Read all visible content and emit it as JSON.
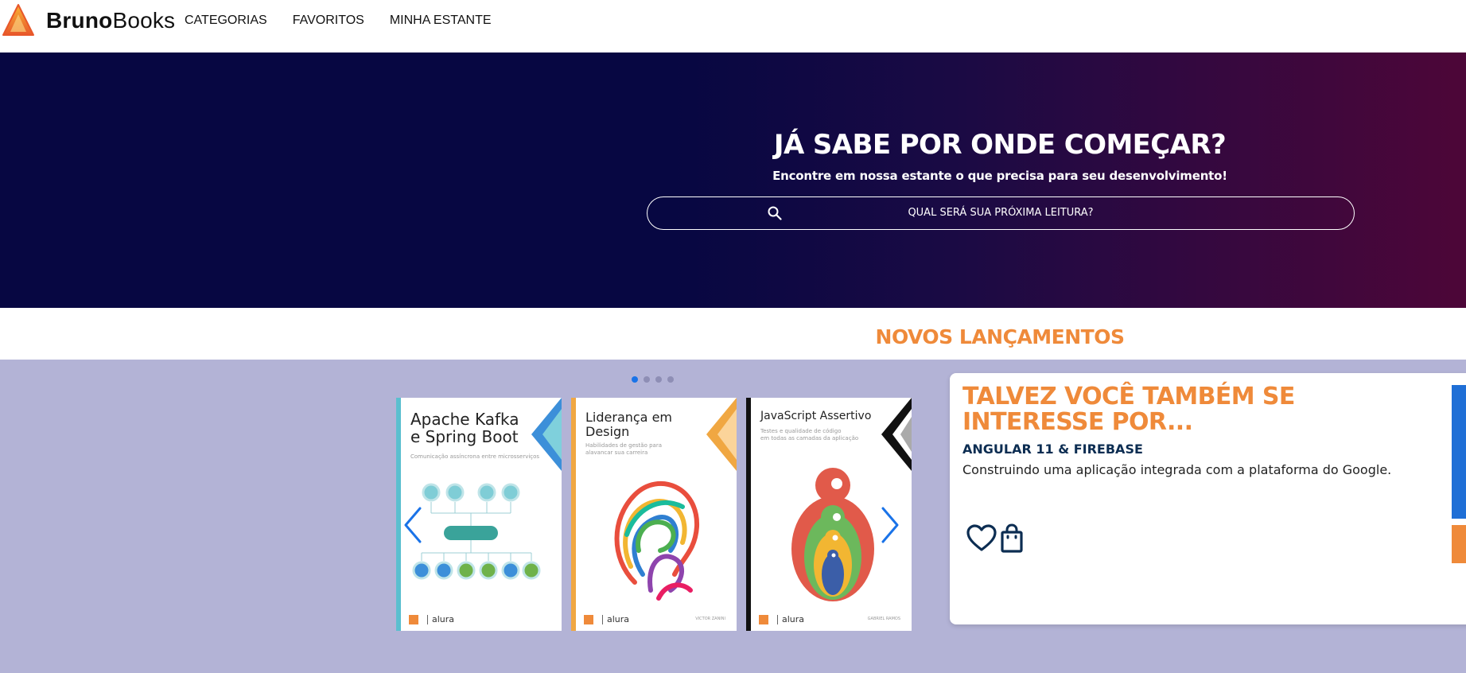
{
  "header": {
    "brand_bold": "Bruno",
    "brand_light": "Books",
    "nav": [
      {
        "label": "CATEGORIAS"
      },
      {
        "label": "FAVORITOS"
      },
      {
        "label": "MINHA ESTANTE"
      }
    ]
  },
  "hero": {
    "title": "JÁ SABE POR ONDE COMEÇAR?",
    "subtitle": "Encontre em nossa estante o que precisa para seu desenvolvimento!",
    "search_placeholder": "QUAL SERÁ SUA PRÓXIMA LEITURA?",
    "search_icon": "search-icon"
  },
  "releases": {
    "title": "NOVOS LANÇAMENTOS",
    "active_page": 1,
    "books": [
      {
        "title_line1": "Apache Kafka",
        "title_line2": "e Spring Boot",
        "subtitle": "Comunicação assíncrona entre microsserviços",
        "accent": "#5bbfcf",
        "publisher": "alura"
      },
      {
        "title_line1": "Liderança em",
        "title_line2": "Design",
        "subtitle": "Habilidades de gestão para\nalavancar sua carreira",
        "accent": "#f0a742",
        "publisher": "alura",
        "author": "VICTOR ZANINI"
      },
      {
        "title_line1": "JavaScript Assertivo",
        "title_line2": "",
        "subtitle": "Testes e qualidade de código\nem todas as camadas da aplicação",
        "accent": "#111111",
        "publisher": "alura",
        "author": "GABRIEL RAMOS"
      }
    ],
    "prev_icon": "chevron-left-icon",
    "next_icon": "chevron-right-icon"
  },
  "suggestion": {
    "title": "TALVEZ VOCÊ TAMBÉM SE INTERESSE POR...",
    "book_title": "ANGULAR 11 & FIREBASE",
    "book_description": "Construindo uma aplicação integrada com a plataforma do Google.",
    "favorite_icon": "heart-icon",
    "bag_icon": "shopping-bag-icon"
  },
  "colors": {
    "accent_orange": "#ef8a3a",
    "navy": "#070742",
    "band": "#b3b3d6",
    "dark_blue_text": "#0c2d52",
    "active_dot": "#1a73e8"
  }
}
